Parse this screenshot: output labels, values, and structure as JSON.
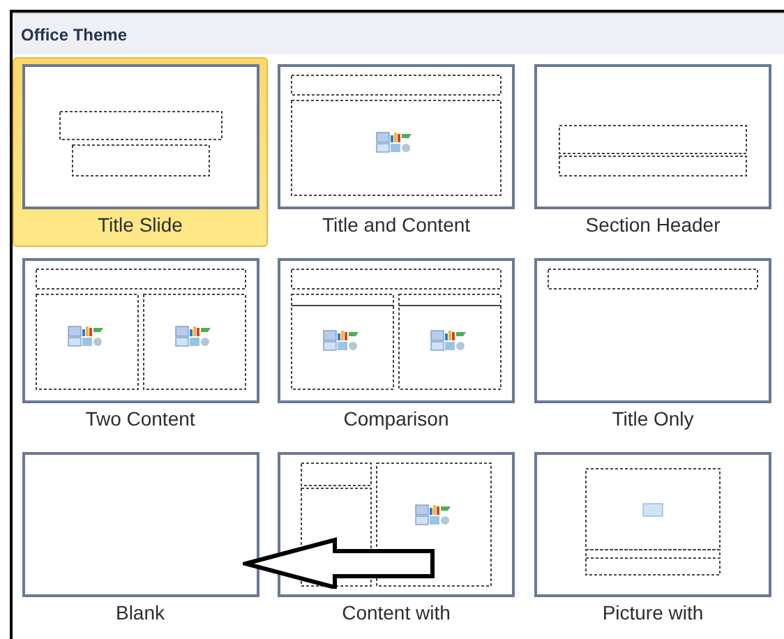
{
  "gallery": {
    "title": "Office Theme",
    "layouts": [
      {
        "label": "Title Slide",
        "kind": "title",
        "selected": true
      },
      {
        "label": "Title and Content",
        "kind": "title-content",
        "selected": false
      },
      {
        "label": "Section Header",
        "kind": "section",
        "selected": false
      },
      {
        "label": "Two Content",
        "kind": "two-content",
        "selected": false
      },
      {
        "label": "Comparison",
        "kind": "comparison",
        "selected": false
      },
      {
        "label": "Title Only",
        "kind": "title-only",
        "selected": false
      },
      {
        "label": "Blank",
        "kind": "blank",
        "selected": false
      },
      {
        "label": "Content with",
        "kind": "content-caption",
        "selected": false
      },
      {
        "label": "Picture with",
        "kind": "picture-caption",
        "selected": false
      }
    ]
  }
}
